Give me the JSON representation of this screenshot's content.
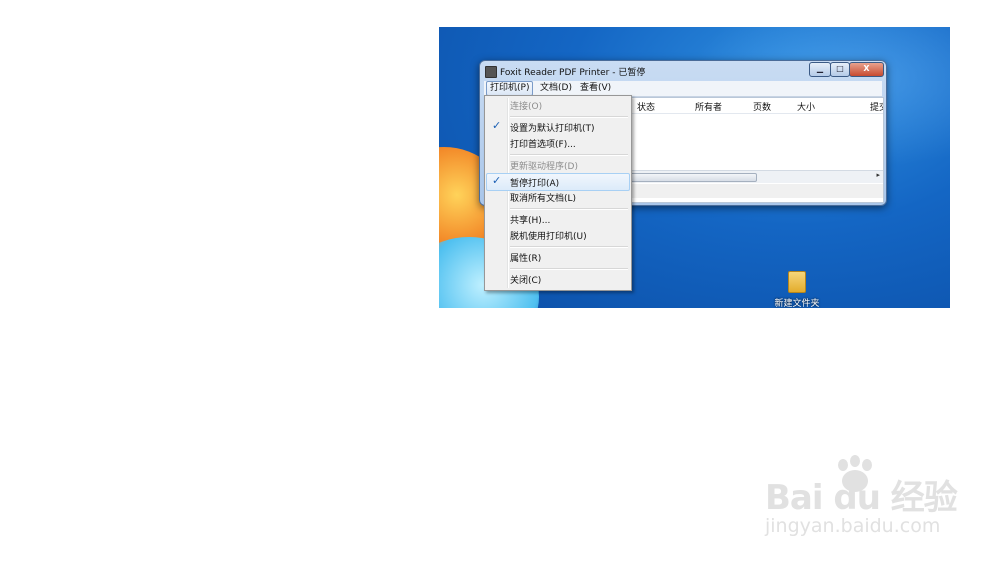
{
  "window": {
    "title": "Foxit Reader PDF Printer - 已暂停",
    "buttons": {
      "minimize": "▁",
      "maximize": "□",
      "close": "X"
    }
  },
  "menubar": [
    {
      "label": "打印机(P)",
      "active": true
    },
    {
      "label": "文档(D)"
    },
    {
      "label": "查看(V)"
    }
  ],
  "columns": [
    "状态",
    "所有者",
    "页数",
    "大小",
    "提交"
  ],
  "printer_menu": [
    {
      "label": "连接(O)",
      "disabled": true
    },
    {
      "label": "设置为默认打印机(T)",
      "checked": true
    },
    {
      "label": "打印首选项(F)..."
    },
    {
      "label": "更新驱动程序(D)",
      "disabled": true
    },
    {
      "label": "暂停打印(A)",
      "checked": true,
      "highlighted": true
    },
    {
      "label": "取消所有文档(L)"
    },
    {
      "label": "共享(H)..."
    },
    {
      "label": "脱机使用打印机(U)"
    },
    {
      "label": "属性(R)"
    },
    {
      "label": "关闭(C)"
    }
  ],
  "desktop": {
    "folder_label": "新建文件夹"
  },
  "watermark": {
    "logo_text": "Bai du 经验",
    "url": "jingyan.baidu.com"
  },
  "icons": {
    "check": "✓",
    "scroll_right": "▸"
  }
}
